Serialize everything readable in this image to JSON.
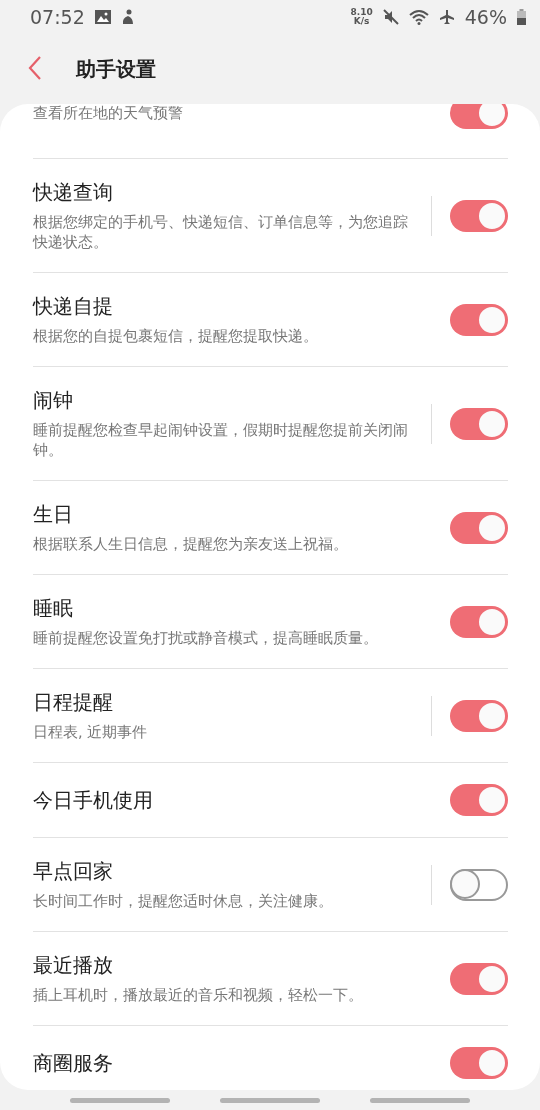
{
  "status_bar": {
    "time": "07:52",
    "speed_value": "8.10",
    "speed_unit": "K/s",
    "battery": "46%"
  },
  "header": {
    "title": "助手设置"
  },
  "settings": [
    {
      "subtitle": "查看所在地的天气预警",
      "on": true,
      "has_detail": false,
      "cut": true
    },
    {
      "title": "快递查询",
      "subtitle": "根据您绑定的手机号、快递短信、订单信息等，为您追踪快递状态。",
      "on": true,
      "has_detail": true
    },
    {
      "title": "快递自提",
      "subtitle": "根据您的自提包裹短信，提醒您提取快递。",
      "on": true,
      "has_detail": false
    },
    {
      "title": "闹钟",
      "subtitle": "睡前提醒您检查早起闹钟设置，假期时提醒您提前关闭闹钟。",
      "on": true,
      "has_detail": true
    },
    {
      "title": "生日",
      "subtitle": "根据联系人生日信息，提醒您为亲友送上祝福。",
      "on": true,
      "has_detail": false
    },
    {
      "title": "睡眠",
      "subtitle": "睡前提醒您设置免打扰或静音模式，提高睡眠质量。",
      "on": true,
      "has_detail": false
    },
    {
      "title": "日程提醒",
      "subtitle": "日程表, 近期事件",
      "on": true,
      "has_detail": true
    },
    {
      "title": "今日手机使用",
      "on": true,
      "has_detail": false
    },
    {
      "title": "早点回家",
      "subtitle": "长时间工作时，提醒您适时休息，关注健康。",
      "on": false,
      "has_detail": true
    },
    {
      "title": "最近播放",
      "subtitle": "插上耳机时，播放最近的音乐和视频，轻松一下。",
      "on": true,
      "has_detail": false
    },
    {
      "title": "商圈服务",
      "on": true,
      "has_detail": false
    }
  ]
}
